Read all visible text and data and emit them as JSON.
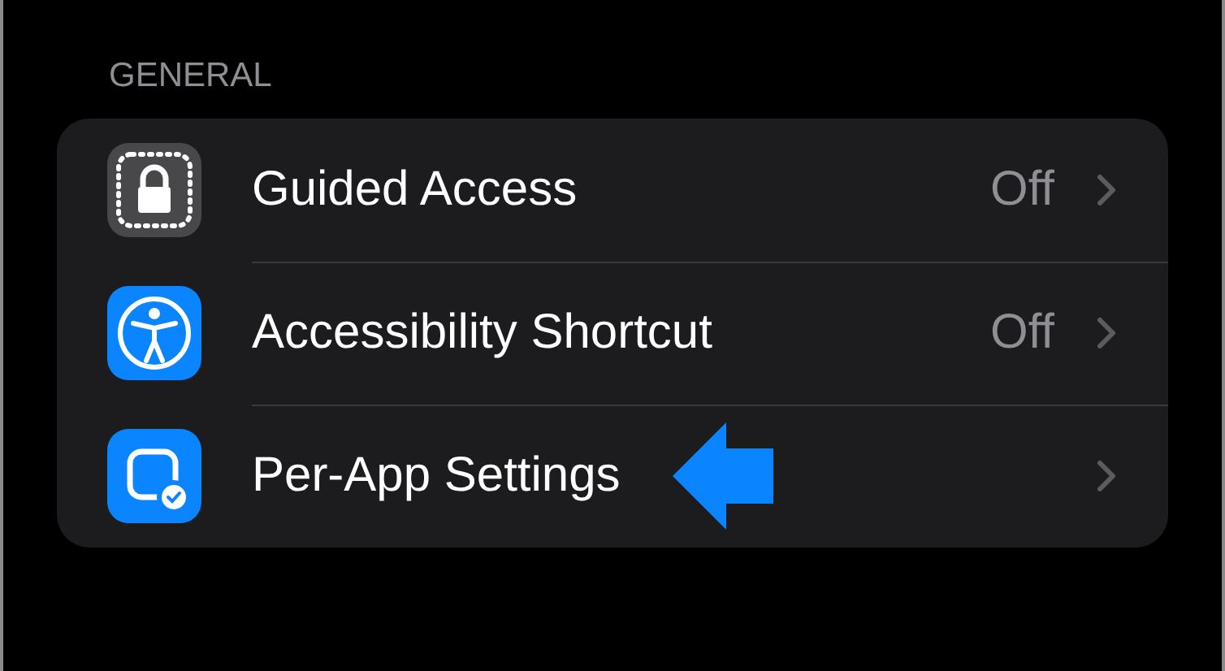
{
  "section": {
    "header": "GENERAL",
    "rows": [
      {
        "kind": "lock",
        "label": "Guided Access",
        "value": "Off",
        "highlighted": false
      },
      {
        "kind": "accessibility",
        "label": "Accessibility Shortcut",
        "value": "Off",
        "highlighted": false
      },
      {
        "kind": "app-check",
        "label": "Per-App Settings",
        "highlighted": true
      }
    ]
  }
}
